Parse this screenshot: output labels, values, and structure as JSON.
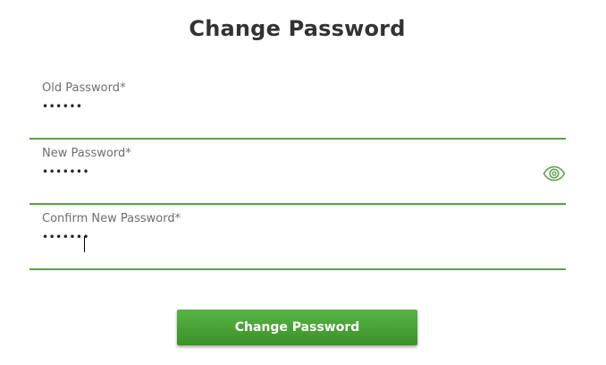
{
  "page_title": "Change Password",
  "form": {
    "old_password": {
      "label": "Old Password*",
      "value": "••••••"
    },
    "new_password": {
      "label": "New Password*",
      "value": "•••••••",
      "toggle_icon": "eye-icon"
    },
    "confirm_password": {
      "label": "Confirm New Password*",
      "value": "•••••••"
    },
    "submit_label": "Change Password"
  },
  "colors": {
    "accent": "#5aa048",
    "button_top": "#57b443",
    "button_bottom": "#3c9129",
    "title": "#333333",
    "label": "#6e6e6e"
  }
}
